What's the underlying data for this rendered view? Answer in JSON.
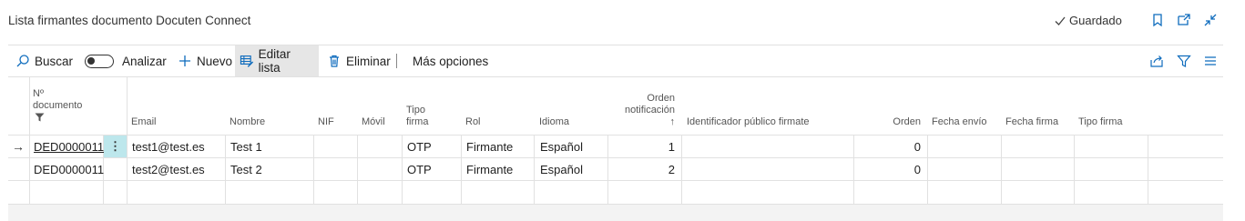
{
  "page": {
    "title": "Lista firmantes documento Docuten Connect",
    "saved_status": "Guardado"
  },
  "header_icons": [
    "bookmark-icon",
    "open-new-window-icon",
    "collapse-icon"
  ],
  "actions": {
    "search": "Buscar",
    "analyze": "Analizar",
    "new": "Nuevo",
    "edit_list": "Editar lista",
    "delete": "Eliminar",
    "more": "Más opciones"
  },
  "toolbar_right_icons": [
    "share-icon",
    "filter-icon",
    "list-view-icon"
  ],
  "columns": {
    "doc": [
      "Nº",
      "documento"
    ],
    "email": "Email",
    "nombre": "Nombre",
    "nif": "NIF",
    "movil": "Móvil",
    "tipo_firma": [
      "Tipo",
      "firma"
    ],
    "rol": "Rol",
    "idioma": "Idioma",
    "orden_notif": [
      "Orden",
      "notificación",
      "↑"
    ],
    "identificador": "Identificador público firmate",
    "orden": "Orden",
    "fecha_envio": "Fecha envío",
    "fecha_firma": "Fecha firma",
    "tipo_firma2": "Tipo firma"
  },
  "rows": [
    {
      "selected": true,
      "doc": "DED0000011",
      "email": "test1@test.es",
      "nombre": "Test 1",
      "nif": "",
      "movil": "",
      "tipo_firma": "OTP",
      "rol": "Firmante",
      "idioma": "Español",
      "orden_notif": "1",
      "identificador": "",
      "orden": "0",
      "fecha_envio": "",
      "fecha_firma": "",
      "tipo_firma2": ""
    },
    {
      "selected": false,
      "doc": "DED0000011",
      "email": "test2@test.es",
      "nombre": "Test 2",
      "nif": "",
      "movil": "",
      "tipo_firma": "OTP",
      "rol": "Firmante",
      "idioma": "Español",
      "orden_notif": "2",
      "identificador": "",
      "orden": "0",
      "fecha_envio": "",
      "fecha_firma": "",
      "tipo_firma2": ""
    }
  ],
  "row_indicator": "→",
  "row_menu": "⋮",
  "colors": {
    "accent": "#0f6cbd",
    "row_menu_bg": "#bde7ec",
    "active_action_bg": "#e6e6e6",
    "grid_line": "#e1e1e1"
  }
}
